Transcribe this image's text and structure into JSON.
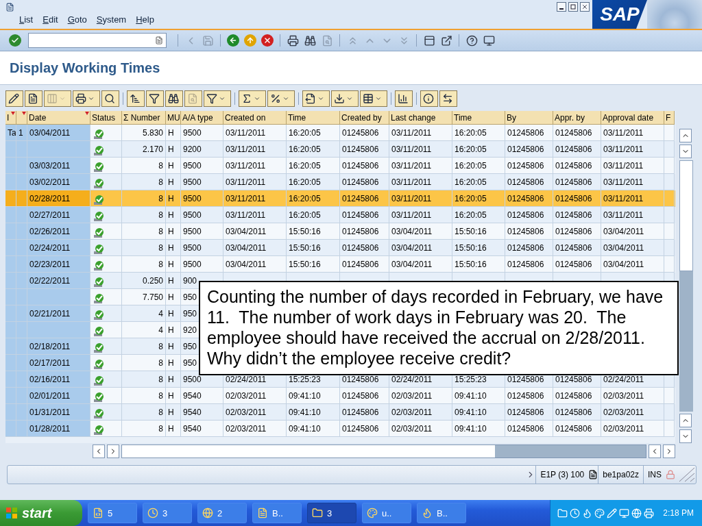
{
  "window": {
    "logo": "SAP",
    "menu": [
      "List",
      "Edit",
      "Goto",
      "System",
      "Help"
    ]
  },
  "system_toolbar": [
    {
      "disabled": false
    },
    {
      "disabled": true
    },
    {
      "disabled": true
    },
    {
      "disabled": false
    },
    {
      "disabled": false
    },
    {
      "disabled": false
    },
    {
      "disabled": false
    },
    {
      "disabled": false
    },
    {
      "disabled": true
    },
    {
      "disabled": true
    },
    {
      "disabled": true
    },
    {
      "disabled": true
    },
    {
      "disabled": true
    },
    {
      "disabled": false
    },
    {
      "disabled": false
    },
    {
      "disabled": false
    },
    {
      "disabled": false
    }
  ],
  "title": "Display Working Times",
  "app_toolbar": [
    {
      "disabled": false,
      "menu": false
    },
    {
      "disabled": false,
      "menu": false
    },
    {
      "disabled": true,
      "menu": true
    },
    {
      "disabled": false,
      "menu": true
    },
    {
      "disabled": false,
      "menu": false
    },
    {
      "disabled": false,
      "menu": false
    },
    {
      "disabled": false,
      "menu": false
    },
    {
      "disabled": false,
      "menu": false
    },
    {
      "disabled": true,
      "menu": false
    },
    {
      "disabled": false,
      "menu": true
    },
    {
      "disabled": false,
      "menu": true
    },
    {
      "disabled": false,
      "menu": true
    },
    {
      "disabled": false,
      "menu": true
    },
    {
      "disabled": false,
      "menu": true
    },
    {
      "disabled": false,
      "menu": true
    },
    {
      "disabled": false,
      "menu": false
    },
    {
      "disabled": false,
      "menu": false
    },
    {
      "disabled": false,
      "menu": false
    }
  ],
  "table": {
    "columns": [
      {
        "label": "I",
        "sort_marker": true
      },
      {
        "sort_marker": true
      },
      {
        "label": "Date",
        "sort_marker": true
      },
      {
        "label": "Status",
        "sort_marker": false
      },
      {
        "label": "Σ Number",
        "sort_marker": false
      },
      {
        "label": "MU",
        "sort_marker": false
      },
      {
        "label": "A/A type",
        "sort_marker": false
      },
      {
        "label": "Created on",
        "sort_marker": false
      },
      {
        "label": "Time",
        "sort_marker": false
      },
      {
        "label": "Created by",
        "sort_marker": false
      },
      {
        "label": "Last change",
        "sort_marker": false
      },
      {
        "label": "Time",
        "sort_marker": false
      },
      {
        "label": "By",
        "sort_marker": false
      },
      {
        "label": "Appr. by",
        "sort_marker": false
      },
      {
        "label": "Approval date",
        "sort_marker": false
      },
      {
        "label": "F",
        "sort_marker": false
      }
    ],
    "rows": [
      {
        "selected": false,
        "tag": "Ta",
        "count": "1",
        "date": "03/04/2011",
        "number": "5.830",
        "unit": "H",
        "aa_type": "9500",
        "created_on": "03/11/2011",
        "time": "16:20:05",
        "created_by": "01245806",
        "last_change": "03/11/2011",
        "change_time": "16:20:05",
        "by": "01245806",
        "appr_by": "01245806",
        "approval_date": "03/11/2011"
      },
      {
        "selected": false,
        "number": "2.170",
        "unit": "H",
        "aa_type": "9200",
        "created_on": "03/11/2011",
        "time": "16:20:05",
        "created_by": "01245806",
        "last_change": "03/11/2011",
        "change_time": "16:20:05",
        "by": "01245806",
        "appr_by": "01245806",
        "approval_date": "03/11/2011"
      },
      {
        "selected": false,
        "date": "03/03/2011",
        "number": "8",
        "unit": "H",
        "aa_type": "9500",
        "created_on": "03/11/2011",
        "time": "16:20:05",
        "created_by": "01245806",
        "last_change": "03/11/2011",
        "change_time": "16:20:05",
        "by": "01245806",
        "appr_by": "01245806",
        "approval_date": "03/11/2011"
      },
      {
        "selected": false,
        "date": "03/02/2011",
        "number": "8",
        "unit": "H",
        "aa_type": "9500",
        "created_on": "03/11/2011",
        "time": "16:20:05",
        "created_by": "01245806",
        "last_change": "03/11/2011",
        "change_time": "16:20:05",
        "by": "01245806",
        "appr_by": "01245806",
        "approval_date": "03/11/2011"
      },
      {
        "selected": true,
        "date": "02/28/2011",
        "number": "8",
        "unit": "H",
        "aa_type": "9500",
        "created_on": "03/11/2011",
        "time": "16:20:05",
        "created_by": "01245806",
        "last_change": "03/11/2011",
        "change_time": "16:20:05",
        "by": "01245806",
        "appr_by": "01245806",
        "approval_date": "03/11/2011"
      },
      {
        "selected": false,
        "date": "02/27/2011",
        "number": "8",
        "unit": "H",
        "aa_type": "9500",
        "created_on": "03/11/2011",
        "time": "16:20:05",
        "created_by": "01245806",
        "last_change": "03/11/2011",
        "change_time": "16:20:05",
        "by": "01245806",
        "appr_by": "01245806",
        "approval_date": "03/11/2011"
      },
      {
        "selected": false,
        "date": "02/26/2011",
        "number": "8",
        "unit": "H",
        "aa_type": "9500",
        "created_on": "03/04/2011",
        "time": "15:50:16",
        "created_by": "01245806",
        "last_change": "03/04/2011",
        "change_time": "15:50:16",
        "by": "01245806",
        "appr_by": "01245806",
        "approval_date": "03/04/2011"
      },
      {
        "selected": false,
        "date": "02/24/2011",
        "number": "8",
        "unit": "H",
        "aa_type": "9500",
        "created_on": "03/04/2011",
        "time": "15:50:16",
        "created_by": "01245806",
        "last_change": "03/04/2011",
        "change_time": "15:50:16",
        "by": "01245806",
        "appr_by": "01245806",
        "approval_date": "03/04/2011"
      },
      {
        "selected": false,
        "date": "02/23/2011",
        "number": "8",
        "unit": "H",
        "aa_type": "9500",
        "created_on": "03/04/2011",
        "time": "15:50:16",
        "created_by": "01245806",
        "last_change": "03/04/2011",
        "change_time": "15:50:16",
        "by": "01245806",
        "appr_by": "01245806",
        "approval_date": "03/04/2011"
      },
      {
        "selected": false,
        "date": "02/22/2011",
        "number": "0.250",
        "unit": "H",
        "aa_type": "900"
      },
      {
        "selected": false,
        "number": "7.750",
        "unit": "H",
        "aa_type": "950"
      },
      {
        "selected": false,
        "date": "02/21/2011",
        "number": "4",
        "unit": "H",
        "aa_type": "950"
      },
      {
        "selected": false,
        "number": "4",
        "unit": "H",
        "aa_type": "920"
      },
      {
        "selected": false,
        "date": "02/18/2011",
        "number": "8",
        "unit": "H",
        "aa_type": "950"
      },
      {
        "selected": false,
        "date": "02/17/2011",
        "number": "8",
        "unit": "H",
        "aa_type": "950"
      },
      {
        "selected": false,
        "date": "02/16/2011",
        "number": "8",
        "unit": "H",
        "aa_type": "9500",
        "created_on": "02/24/2011",
        "time": "15:25:23",
        "created_by": "01245806",
        "last_change": "02/24/2011",
        "change_time": "15:25:23",
        "by": "01245806",
        "appr_by": "01245806",
        "approval_date": "02/24/2011"
      },
      {
        "selected": false,
        "date": "02/01/2011",
        "number": "8",
        "unit": "H",
        "aa_type": "9540",
        "created_on": "02/03/2011",
        "time": "09:41:10",
        "created_by": "01245806",
        "last_change": "02/03/2011",
        "change_time": "09:41:10",
        "by": "01245806",
        "appr_by": "01245806",
        "approval_date": "02/03/2011"
      },
      {
        "selected": false,
        "date": "01/31/2011",
        "number": "8",
        "unit": "H",
        "aa_type": "9540",
        "created_on": "02/03/2011",
        "time": "09:41:10",
        "created_by": "01245806",
        "last_change": "02/03/2011",
        "change_time": "09:41:10",
        "by": "01245806",
        "appr_by": "01245806",
        "approval_date": "02/03/2011"
      },
      {
        "selected": false,
        "date": "01/28/2011",
        "number": "8",
        "unit": "H",
        "aa_type": "9540",
        "created_on": "02/03/2011",
        "time": "09:41:10",
        "created_by": "01245806",
        "last_change": "02/03/2011",
        "change_time": "09:41:10",
        "by": "01245806",
        "appr_by": "01245806",
        "approval_date": "02/03/2011"
      }
    ]
  },
  "callout": "Counting the number of days recorded in February, we have 11.  The number of work days in February was 20.  The employee should have received the accrual on 2/28/2011.  Why didn’t the employee receive credit?",
  "status_bar": {
    "system": "E1P (3) 100",
    "server": "be1pa02z",
    "mode": "INS"
  },
  "taskbar": {
    "start": "start",
    "items": [
      {
        "label": "5",
        "selected": false
      },
      {
        "label": "3",
        "selected": false
      },
      {
        "label": "2",
        "selected": false
      },
      {
        "label": "B..",
        "selected": false
      },
      {
        "label": "3",
        "selected": true
      },
      {
        "label": "u..",
        "selected": false
      },
      {
        "label": "B..",
        "selected": false
      }
    ],
    "clock": "2:18 PM"
  }
}
